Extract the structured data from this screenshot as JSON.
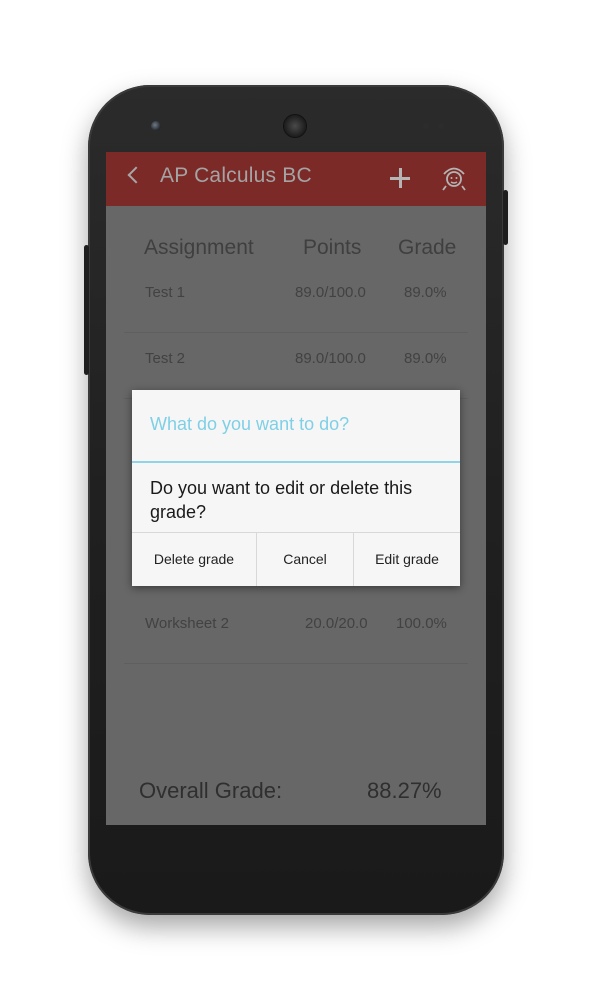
{
  "app": {
    "title": "AP Calculus BC",
    "icons": {
      "back": "chevron-left-icon",
      "add": "plus-icon",
      "profile": "profile-icon"
    },
    "colors": {
      "appbar": "#7b2a27",
      "dialog_accent": "#7fd0e6"
    }
  },
  "table": {
    "headers": {
      "assignment": "Assignment",
      "points": "Points",
      "grade": "Grade"
    },
    "rows": [
      {
        "assignment": "Test 1",
        "points": "89.0/100.0",
        "grade": "89.0%"
      },
      {
        "assignment": "Test 2",
        "points": "89.0/100.0",
        "grade": "89.0%"
      },
      {
        "assignment": "Worksheet 2",
        "points": "20.0/20.0",
        "grade": "100.0%"
      }
    ]
  },
  "overall": {
    "label": "Overall Grade:",
    "value": "88.27%"
  },
  "dialog": {
    "title": "What do you want to do?",
    "message": "Do you want to edit or delete this grade?",
    "buttons": {
      "delete": "Delete grade",
      "cancel": "Cancel",
      "edit": "Edit grade"
    }
  }
}
